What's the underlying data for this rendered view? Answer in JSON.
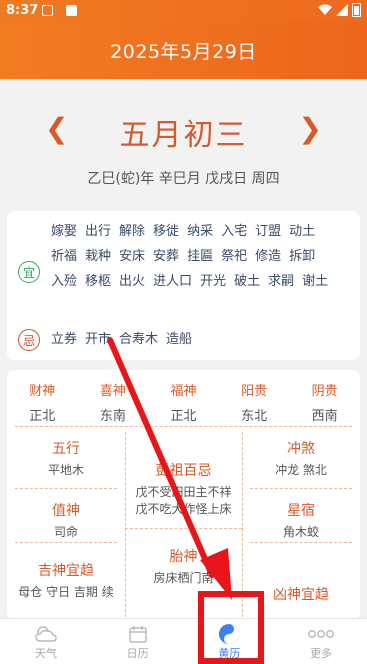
{
  "status": {
    "time": "8:37"
  },
  "header": {
    "title": "2025年5月29日"
  },
  "date": {
    "lunar": "五月初三",
    "ganzhi": "乙巳(蛇)年 辛巳月 戊戌日 周四",
    "prev_icon": "chevron-left-icon",
    "next_icon": "chevron-right-icon"
  },
  "yiji": {
    "yi_badge": "宜",
    "ji_badge": "忌",
    "yi": [
      "嫁娶",
      "出行",
      "解除",
      "移徙",
      "纳采",
      "入宅",
      "订盟",
      "动土",
      "祈福",
      "栽种",
      "安床",
      "安葬",
      "挂匾",
      "祭祀",
      "修造",
      "拆卸",
      "入殓",
      "移柩",
      "出火",
      "进人口",
      "开光",
      "破土",
      "求嗣",
      "谢土"
    ],
    "ji": [
      "立券",
      "开市",
      "合寿木",
      "造船"
    ]
  },
  "gods": [
    {
      "name": "财神",
      "dir": "正北"
    },
    {
      "name": "喜神",
      "dir": "东南"
    },
    {
      "name": "福神",
      "dir": "正北"
    },
    {
      "name": "阳贵",
      "dir": "东北"
    },
    {
      "name": "阴贵",
      "dir": "西南"
    }
  ],
  "cells": {
    "wuxing": {
      "title": "五行",
      "value": "平地木"
    },
    "chongsha": {
      "title": "冲煞",
      "value": "冲龙 煞北"
    },
    "pengzu": {
      "title": "彭祖百忌",
      "line1": "戊不受田田主不祥",
      "line2": "戊不吃犬作怪上床"
    },
    "zhishen": {
      "title": "值神",
      "value": "司命"
    },
    "xingxiu": {
      "title": "星宿",
      "value": "角木蛟"
    },
    "taishen": {
      "title": "胎神",
      "value": "房床栖门南"
    },
    "jishen": {
      "title": "吉神宜趋",
      "value": "母仓 守日 吉期 续"
    },
    "xiongshen": {
      "title": "凶神宜趋",
      "value": ""
    }
  },
  "tabs": [
    {
      "label": "天气",
      "icon": "weather-icon"
    },
    {
      "label": "日历",
      "icon": "calendar-icon"
    },
    {
      "label": "黄历",
      "icon": "yinyang-icon"
    },
    {
      "label": "更多",
      "icon": "more-icon"
    }
  ],
  "annotation_colors": {
    "arrow": "#e8161a",
    "box": "#e8161a"
  }
}
